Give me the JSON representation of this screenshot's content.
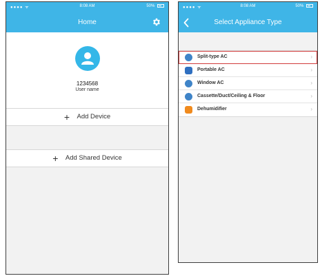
{
  "left_screen": {
    "status": {
      "signal": "●●●● ᯤ",
      "time": "8:08 AM",
      "battery": "50%"
    },
    "title": "Home",
    "icons": {
      "settings": "gear-icon",
      "avatar": "user-icon"
    },
    "user": {
      "id": "1234568",
      "name": "User name"
    },
    "buttons": {
      "add_device_icon": "+",
      "add_device": "Add Device",
      "add_shared_icon": "+",
      "add_shared": "Add Shared Device"
    },
    "colors": {
      "header": "#3fb5e7",
      "avatar": "#34b7e8"
    }
  },
  "right_screen": {
    "status": {
      "signal": "●●●● ᯤ",
      "time": "8:08 AM",
      "battery": "50%"
    },
    "title": "Select Appliance Type",
    "icons": {
      "back": "chevron-left-icon"
    },
    "items": [
      {
        "label": "Split-type AC",
        "icon_color": "#3f84c8",
        "chev": "›",
        "selected": true
      },
      {
        "label": "Portable AC",
        "icon_color": "#2f6fc0",
        "chev": "›",
        "selected": false
      },
      {
        "label": "Window AC",
        "icon_color": "#3f84c8",
        "chev": "›",
        "selected": false
      },
      {
        "label": "Cassette/Duct/Ceiling & Floor",
        "icon_color": "#3f84c8",
        "chev": "›",
        "selected": false
      },
      {
        "label": "Dehumidifier",
        "icon_color": "#f08a1d",
        "chev": "›",
        "selected": false
      }
    ],
    "colors": {
      "selected_outline": "#d13b3b"
    }
  }
}
